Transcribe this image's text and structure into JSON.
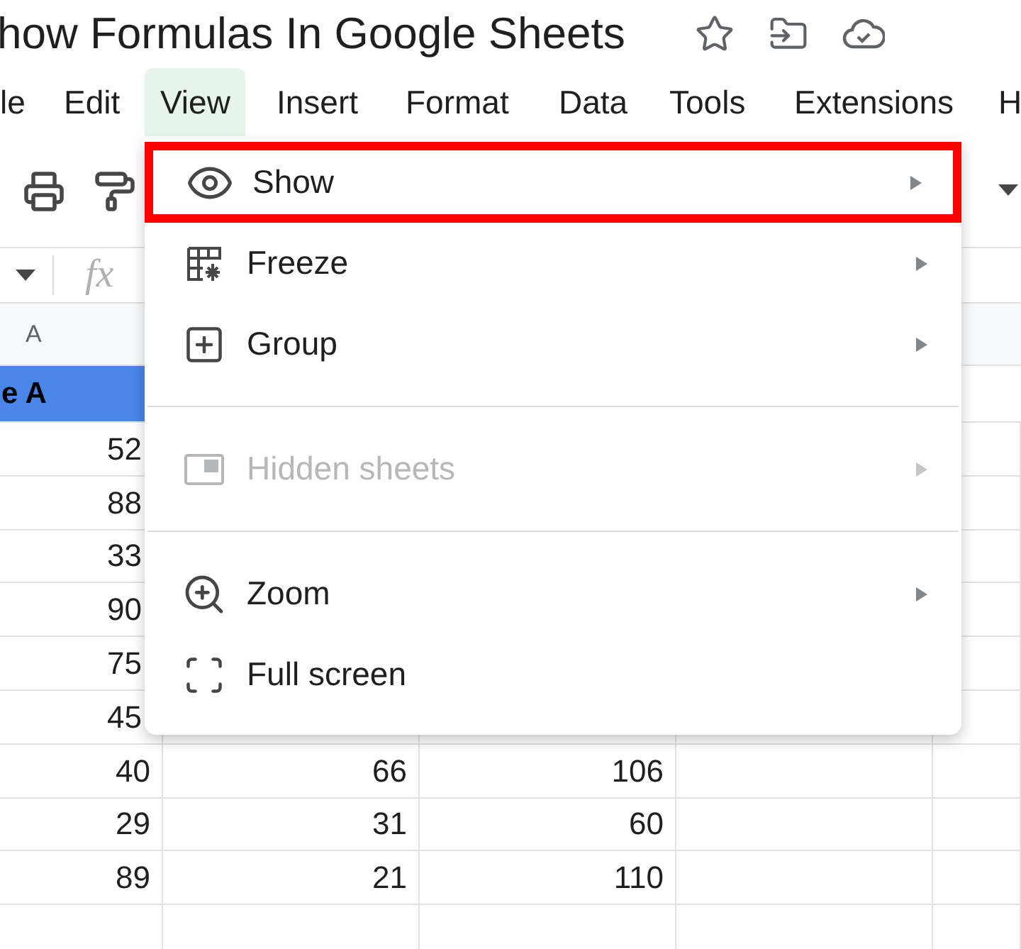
{
  "document": {
    "title": "how Formulas In Google Sheets"
  },
  "menu_bar": [
    {
      "label": "le",
      "selected": false
    },
    {
      "label": "Edit",
      "selected": false
    },
    {
      "label": "View",
      "selected": true
    },
    {
      "label": "Insert",
      "selected": false
    },
    {
      "label": "Format",
      "selected": false
    },
    {
      "label": "Data",
      "selected": false
    },
    {
      "label": "Tools",
      "selected": false
    },
    {
      "label": "Extensions",
      "selected": false
    },
    {
      "label": "H",
      "selected": false
    }
  ],
  "formula_bar": {
    "function_symbol": "fx"
  },
  "sheet": {
    "column_header": "A",
    "header_cell": "e A",
    "rows": [
      [
        "52"
      ],
      [
        "88"
      ],
      [
        "33"
      ],
      [
        "90"
      ],
      [
        "75"
      ],
      [
        "45"
      ],
      [
        "40",
        "66",
        "106"
      ],
      [
        "29",
        "31",
        "60"
      ],
      [
        "89",
        "21",
        "110"
      ]
    ]
  },
  "view_menu": {
    "items": [
      {
        "kind": "item",
        "label": "Show",
        "highlighted": true,
        "disabled": false,
        "submenu": true
      },
      {
        "kind": "item",
        "label": "Freeze",
        "highlighted": false,
        "disabled": false,
        "submenu": true
      },
      {
        "kind": "item",
        "label": "Group",
        "highlighted": false,
        "disabled": false,
        "submenu": true
      },
      {
        "kind": "divider"
      },
      {
        "kind": "item",
        "label": "Hidden sheets",
        "highlighted": false,
        "disabled": true,
        "submenu": true
      },
      {
        "kind": "divider"
      },
      {
        "kind": "item",
        "label": "Zoom",
        "highlighted": false,
        "disabled": false,
        "submenu": true
      },
      {
        "kind": "item",
        "label": "Full screen",
        "highlighted": false,
        "disabled": false,
        "submenu": false
      }
    ]
  }
}
